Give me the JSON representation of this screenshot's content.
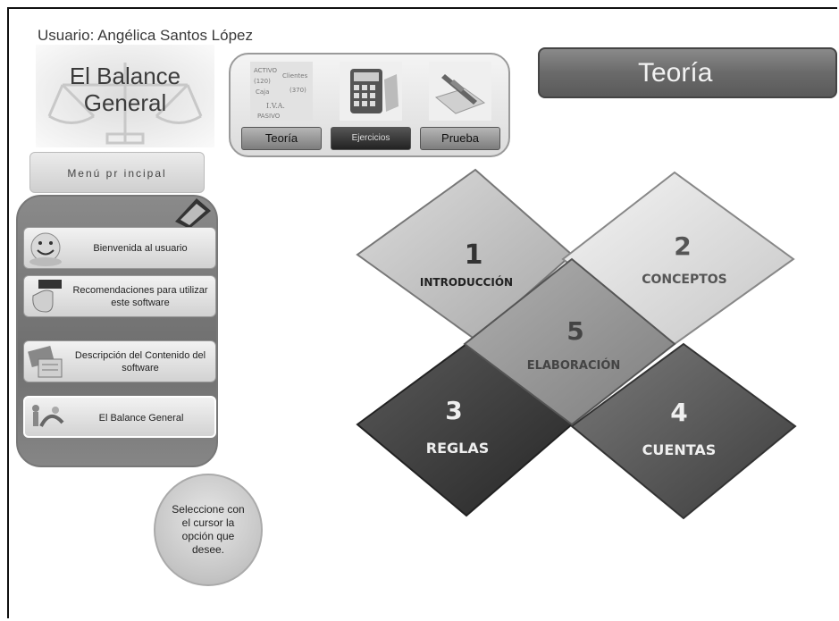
{
  "user": {
    "label": "Usuario: Angélica Santos López"
  },
  "app": {
    "title": "El Balance\nGeneral"
  },
  "toolbar": {
    "items": [
      {
        "label": "Teoría",
        "icon": "accounting-terms-icon"
      },
      {
        "label": "Ejercicios",
        "icon": "calculator-icon"
      },
      {
        "label": "Prueba",
        "icon": "pen-paper-icon"
      }
    ]
  },
  "section": {
    "title": "Teoría"
  },
  "menu": {
    "title": "Menú pr incipal",
    "items": [
      {
        "label": "Bienvenida al usuario",
        "icon": "smiley-icon"
      },
      {
        "label": "Recomendaciones para utilizar este software",
        "icon": "hand-pointer-icon"
      },
      {
        "label": "Descripción del Contenido del software",
        "icon": "documents-icon"
      },
      {
        "label": "El Balance General",
        "icon": "people-scale-icon"
      }
    ]
  },
  "hint": {
    "text": "Seleccione con el cursor la opción que desee."
  },
  "topics": [
    {
      "number": "1",
      "label": "INTRODUCCIÓN"
    },
    {
      "number": "2",
      "label": "CONCEPTOS"
    },
    {
      "number": "5",
      "label": "ELABORACIÓN"
    },
    {
      "number": "3",
      "label": "REGLAS"
    },
    {
      "number": "4",
      "label": "CUENTAS"
    }
  ],
  "colors": {
    "toolbar_button": "#9a9a9a",
    "section_header": "#6a6a6a",
    "menu_panel": "#7a7a7a"
  }
}
